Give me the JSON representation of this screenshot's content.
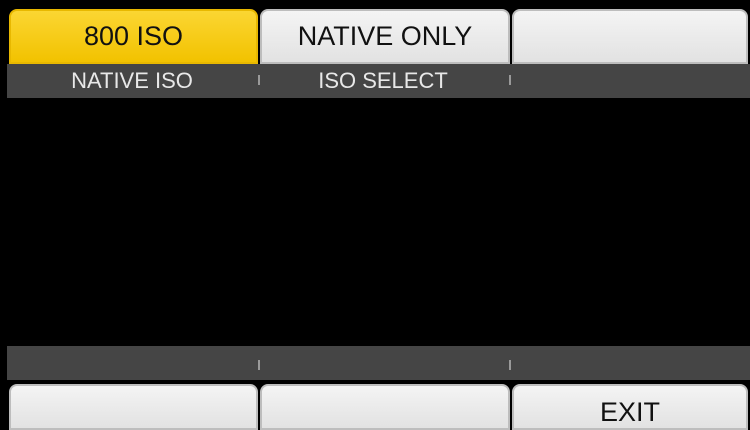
{
  "top_buttons": [
    {
      "label": "800 ISO",
      "active": true
    },
    {
      "label": "NATIVE ONLY",
      "active": false
    },
    {
      "label": "",
      "active": false
    }
  ],
  "top_labels": [
    "NATIVE ISO",
    "ISO SELECT",
    ""
  ],
  "bottom_labels": [
    "",
    "",
    ""
  ],
  "bottom_buttons": [
    {
      "label": ""
    },
    {
      "label": ""
    },
    {
      "label": "EXIT"
    }
  ],
  "colors": {
    "active_button": "#f2c200",
    "button": "#e6e6e6",
    "strip": "#454545",
    "background": "#000000"
  }
}
